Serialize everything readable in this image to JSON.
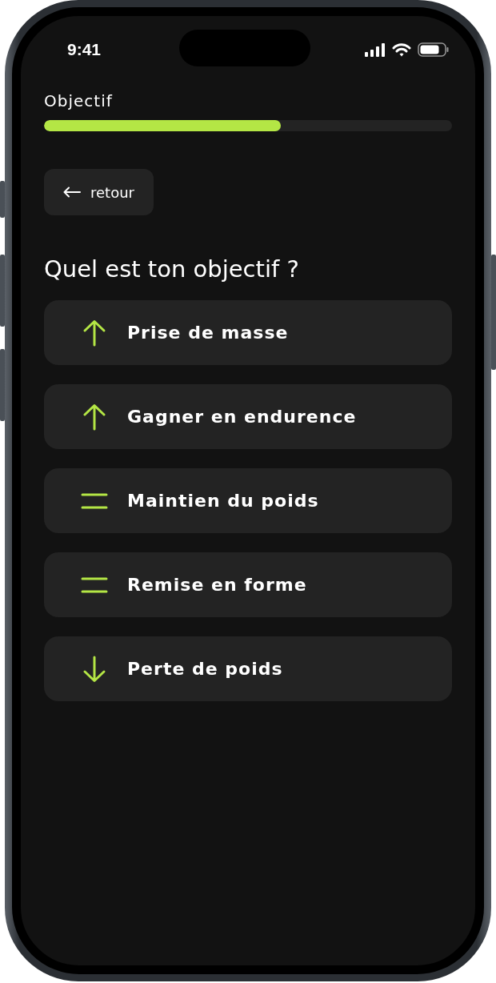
{
  "status_bar": {
    "time": "9:41"
  },
  "progress": {
    "label": "Objectif",
    "level": 0.58
  },
  "back_button": {
    "label": "retour"
  },
  "question": "Quel est ton objectif ?",
  "options": [
    {
      "label": "Prise de masse",
      "kind": "up"
    },
    {
      "label": "Gagner en endurence",
      "kind": "up"
    },
    {
      "label": "Maintien du poids",
      "kind": "equal"
    },
    {
      "label": "Remise en forme",
      "kind": "equal"
    },
    {
      "label": "Perte de poids",
      "kind": "down"
    }
  ]
}
